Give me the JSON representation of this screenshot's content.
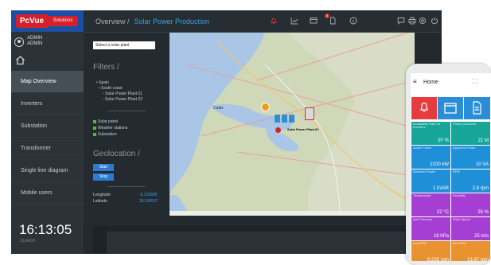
{
  "logo": {
    "brand": "PcVue",
    "sub": "Solutions"
  },
  "user": {
    "name": "ADMIN",
    "role": "ADMIN"
  },
  "nav": [
    "Map Overview",
    "Inverters",
    "Substation",
    "Transformer",
    "Single line diagram",
    "Mobile users"
  ],
  "clock": {
    "time": "16:13:05",
    "date": "21/04/20"
  },
  "breadcrumb": {
    "root": "Overview /",
    "current": "Solar Power Production"
  },
  "notification_count": "8",
  "filters": {
    "select_placeholder": "Select a solar plant",
    "title": "Filters /",
    "tree": {
      "country": "• Spain",
      "region": "• South coast",
      "plant1": "- Solar Power Plant 01",
      "plant2": "- Solar Power Plant 02"
    },
    "checks": [
      "Solar panel",
      "Weather stations",
      "Substation"
    ]
  },
  "geolocation": {
    "title": "Geolocation /",
    "start": "Start",
    "stop": "Stop",
    "longitude_label": "Longitude",
    "longitude": "-6.315689",
    "latitude_label": "Latitude",
    "latitude": "36.536537"
  },
  "map": {
    "plant_label": "Solar Power Plant 01",
    "city": "Cadiz"
  },
  "bottom": {
    "right_top": "07",
    "right_bottom": "00"
  },
  "phone": {
    "title": "Home",
    "tiles": [
      {
        "label": "Availability Rate for Inverters",
        "value": "97 %"
      },
      {
        "label": "Power produced",
        "value": "21 M"
      },
      {
        "label": "Active Power",
        "value": "2100 kW"
      },
      {
        "label": "Apparent Power",
        "value": "10 VA"
      },
      {
        "label": "Reactive Power",
        "value": "1 kVAR"
      },
      {
        "label": "RPM",
        "value": "2.8 rpm"
      },
      {
        "label": "Temperature",
        "value": "22 °C"
      },
      {
        "label": "Humidity",
        "value": "25 %"
      },
      {
        "label": "Atm Pressure",
        "value": "18 hPa"
      },
      {
        "label": "Wind Speed",
        "value": "25 m/s"
      },
      {
        "label": "Avg RPM",
        "value": "8.235 rpm"
      },
      {
        "label": "Min RPM",
        "value": "13.47 rpm"
      }
    ]
  },
  "colors": {
    "accent": "#3aa2e0",
    "sidebar_active": "#474f56",
    "tile_red": "#e63c40",
    "tile_teal": "#17a59a",
    "tile_blue": "#1f8fd8",
    "tile_purple": "#a53fd3",
    "tile_orange": "#e8932f"
  }
}
